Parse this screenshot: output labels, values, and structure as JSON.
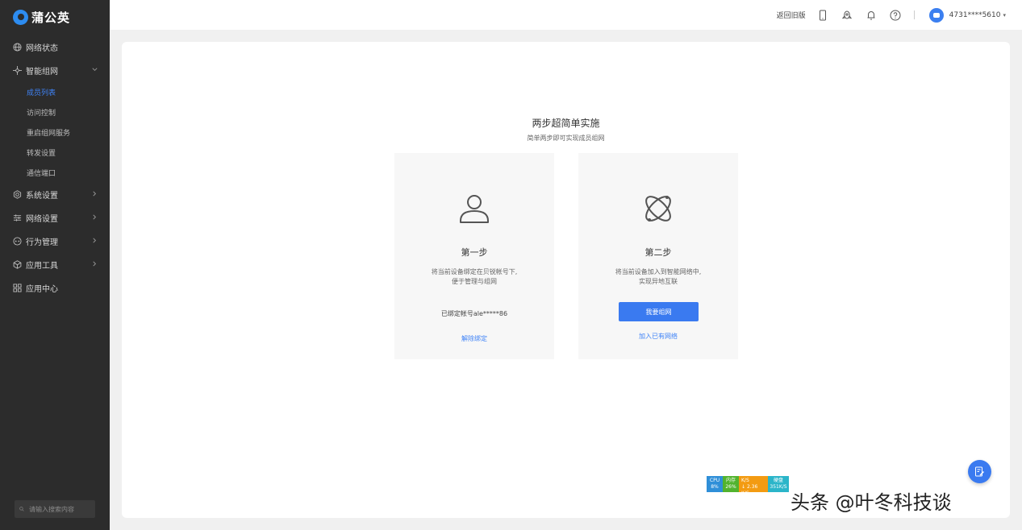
{
  "sidebar": {
    "logo_text": "蒲公英",
    "items": [
      {
        "label": "网络状态",
        "icon": "globe-icon"
      },
      {
        "label": "智能组网",
        "icon": "network-icon",
        "expanded": true,
        "children": [
          {
            "label": "成员列表",
            "active": true
          },
          {
            "label": "访问控制"
          },
          {
            "label": "重启组网服务"
          },
          {
            "label": "转发设置"
          },
          {
            "label": "通信端口"
          }
        ]
      },
      {
        "label": "系统设置",
        "icon": "gear-icon"
      },
      {
        "label": "网络设置",
        "icon": "sliders-icon"
      },
      {
        "label": "行为管理",
        "icon": "eye-icon"
      },
      {
        "label": "应用工具",
        "icon": "box-icon"
      },
      {
        "label": "应用中心",
        "icon": "apps-icon"
      }
    ],
    "search_placeholder": "请输入搜索内容"
  },
  "topbar": {
    "return_old": "返回旧版",
    "account": "4731****5610"
  },
  "main": {
    "title": "两步超简单实施",
    "subtitle": "简单两步即可实现成员组网",
    "step1": {
      "title": "第一步",
      "desc_line1": "将当前设备绑定在贝锐帐号下,",
      "desc_line2": "便于管理与组网",
      "bound_text": "已绑定帐号ale*****86",
      "unbind_link": "解除绑定"
    },
    "step2": {
      "title": "第二步",
      "desc_line1": "将当前设备加入到智能网络中,",
      "desc_line2": "实现异地互联",
      "button": "我要组网",
      "join_link": "加入已有网络"
    }
  },
  "monitor": {
    "cpu_label": "CPU",
    "cpu_value": "8%",
    "mem_label": "内存",
    "mem_value": "26%",
    "up": "2.44 K/S",
    "down": "2.36 K/S",
    "disk_label": "硬盘",
    "disk_value": "351K/S"
  },
  "watermark": "头条 @叶冬科技谈",
  "colors": {
    "accent": "#3a7af0",
    "sidebar_bg": "#2c2c2c"
  }
}
